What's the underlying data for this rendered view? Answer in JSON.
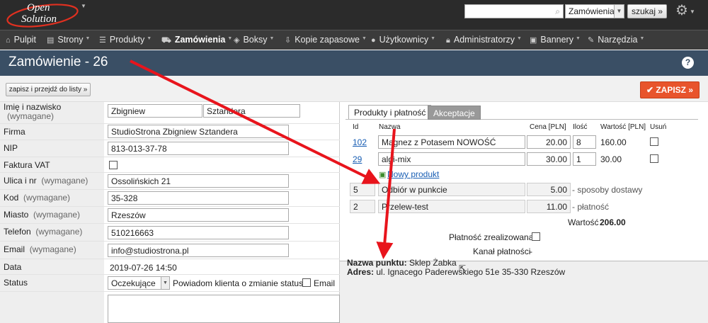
{
  "header": {
    "logo_line1": "Open",
    "logo_line2": "Solution",
    "search_placeholder": "",
    "search_scope": "Zamówienia",
    "search_button": "szukaj »"
  },
  "nav": [
    {
      "label": "Pulpit",
      "icon": "home-icon"
    },
    {
      "label": "Strony",
      "icon": "page-icon"
    },
    {
      "label": "Produkty",
      "icon": "list-icon"
    },
    {
      "label": "Zamówienia",
      "icon": "truck-icon"
    },
    {
      "label": "Boksy",
      "icon": "box-icon"
    },
    {
      "label": "Kopie zapasowe",
      "icon": "backup-icon"
    },
    {
      "label": "Użytkownicy",
      "icon": "user-icon"
    },
    {
      "label": "Administratorzy",
      "icon": "lock-icon"
    },
    {
      "label": "Bannery",
      "icon": "banner-icon"
    },
    {
      "label": "Narzędzia",
      "icon": "wrench-icon"
    }
  ],
  "page": {
    "title": "Zamówienie - 26",
    "help": "?",
    "save_list_button": "zapisz i przejdź do listy »",
    "save_button": "ZAPISZ »"
  },
  "form": {
    "name_label": "Imię i nazwisko",
    "name_req": "(wymagane)",
    "first_name": "Zbigniew",
    "last_name": "Sztandera",
    "company_label": "Firma",
    "company": "StudioStrona Zbigniew Sztandera",
    "nip_label": "NIP",
    "nip": "813-013-37-78",
    "vat_label": "Faktura VAT",
    "street_label": "Ulica i nr",
    "street": "Ossolińskich 21",
    "zip_label": "Kod",
    "zip": "35-328",
    "city_label": "Miasto",
    "city": "Rzeszów",
    "phone_label": "Telefon",
    "phone": "510216663",
    "email_label": "Email",
    "email": "info@studiostrona.pl",
    "date_label": "Data",
    "date": "2019-07-26 14:50",
    "status_label": "Status",
    "status": "Oczekujące",
    "notify_label": "Powiadom klienta o zmianie statusu:",
    "notify_email": "Email",
    "req": "(wymagane)"
  },
  "tabs": [
    "Produkty i płatność",
    "Akceptacje"
  ],
  "products": {
    "headers": [
      "Id",
      "Nazwa",
      "Cena [PLN]",
      "Ilość",
      "Wartość [PLN]",
      "Usuń"
    ],
    "rows": [
      {
        "id": "102",
        "name": "Magnez z Potasem NOWOŚĆ",
        "price": "20.00",
        "qty": "8",
        "value": "160.00"
      },
      {
        "id": "29",
        "name": "algi-mix",
        "price": "30.00",
        "qty": "1",
        "value": "30.00"
      }
    ],
    "new_product": "Nowy produkt",
    "shipping": {
      "id": "5",
      "name": "Odbiór w punkcie",
      "price": "5.00",
      "note": "- sposoby dostawy"
    },
    "payment": {
      "id": "2",
      "name": "Przelew-test",
      "price": "11.00",
      "note": "- płatność"
    },
    "total_label": "Wartość",
    "total": "206.00",
    "paid_label": "Płatność zrealizowana",
    "channel_label": "Kanał płatności",
    "channel": "-"
  },
  "pickup": {
    "point_label": "Nazwa punktu:",
    "point": "Sklep Żabka",
    "address_label": "Adres:",
    "address": "ul. Ignacego Paderewskiego 51e 35-330 Rzeszów"
  },
  "colors": {
    "topbar": "#2b2b2b",
    "nav": "#3b3b3b",
    "titlebar": "#3a4f65",
    "save": "#e8542c",
    "arrow": "#e8141c"
  }
}
